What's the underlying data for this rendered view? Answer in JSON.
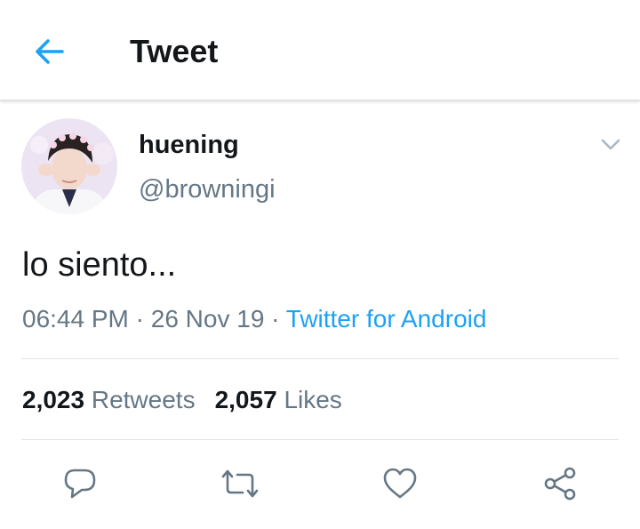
{
  "header": {
    "title": "Tweet",
    "back_icon": "arrow-left-icon"
  },
  "colors": {
    "accent": "#1da1f2",
    "text_primary": "#14171a",
    "text_secondary": "#657786",
    "divider": "#dfe3e7"
  },
  "tweet": {
    "display_name": "huening",
    "handle": "@browningi",
    "text": "lo siento...",
    "time": "06:44 PM",
    "sep1": " · ",
    "date": "26 Nov 19",
    "sep2": " · ",
    "source": "Twitter for Android"
  },
  "stats": {
    "retweets_count": "2,023",
    "retweets_label": "Retweets",
    "likes_count": "2,057",
    "likes_label": "Likes"
  },
  "actions": {
    "reply_icon": "reply-icon",
    "retweet_icon": "retweet-icon",
    "like_icon": "heart-icon",
    "share_icon": "share-icon"
  }
}
